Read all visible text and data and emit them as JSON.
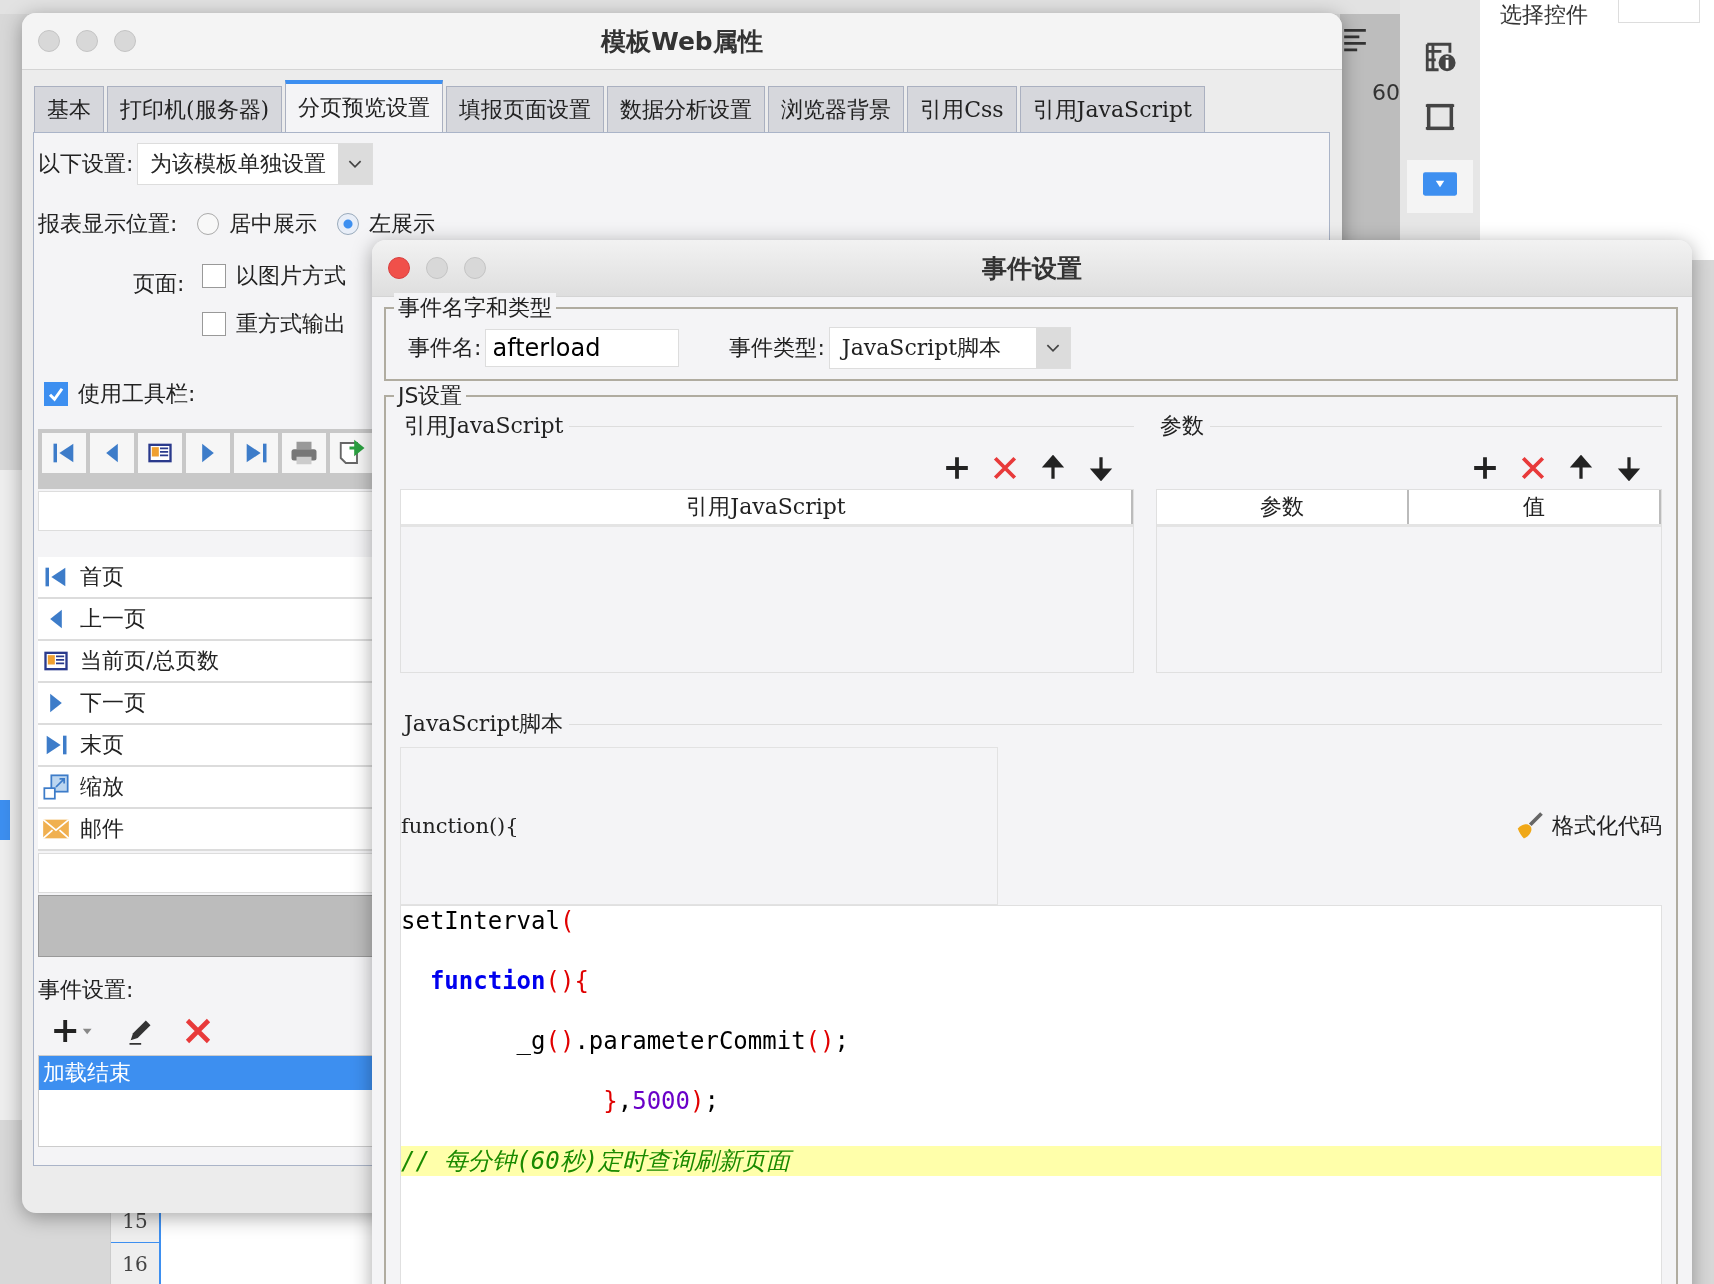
{
  "background": {
    "ruler_number": "60",
    "panel_label": "选择控件",
    "row_numbers": [
      "15",
      "16"
    ]
  },
  "main_window": {
    "title": "模板Web属性",
    "tabs": [
      {
        "label": "基本",
        "selected": false
      },
      {
        "label": "打印机(服务器)",
        "selected": false
      },
      {
        "label": "分页预览设置",
        "selected": true
      },
      {
        "label": "填报页面设置",
        "selected": false
      },
      {
        "label": "数据分析设置",
        "selected": false
      },
      {
        "label": "浏览器背景",
        "selected": false
      },
      {
        "label": "引用Css",
        "selected": false
      },
      {
        "label": "引用JavaScript",
        "selected": false
      }
    ],
    "scope_label": "以下设置:",
    "scope_value": "为该模板单独设置",
    "position_label": "报表显示位置:",
    "position_options": [
      {
        "label": "居中展示",
        "selected": false
      },
      {
        "label": "左展示",
        "selected": true
      }
    ],
    "page_label": "页面:",
    "page_options": [
      {
        "label": "以图片方式",
        "checked": false
      },
      {
        "label": "重方式输出",
        "checked": false
      }
    ],
    "toolbar_toggle": {
      "label": "使用工具栏:",
      "checked": true
    },
    "toolbar_items": [
      {
        "kind": "first",
        "label": "首页"
      },
      {
        "kind": "prev",
        "label": "上一页"
      },
      {
        "kind": "pageinfo",
        "label": "当前页/总页数"
      },
      {
        "kind": "next",
        "label": "下一页"
      },
      {
        "kind": "last",
        "label": "末页"
      },
      {
        "kind": "zoom",
        "label": "缩放"
      },
      {
        "kind": "mail",
        "label": "邮件"
      }
    ],
    "events_label": "事件设置:",
    "events": [
      {
        "label": "加载结束",
        "selected": true
      }
    ]
  },
  "event_dialog": {
    "title": "事件设置",
    "name_group": "事件名字和类型",
    "name_label": "事件名:",
    "name_value": "afterload",
    "type_label": "事件类型:",
    "type_value": "JavaScript脚本",
    "js_group": "JS设置",
    "ref_title": "引用JavaScript",
    "ref_columns": [
      "引用JavaScript"
    ],
    "param_title": "参数",
    "param_columns": [
      "参数",
      "值"
    ],
    "script_title": "JavaScript脚本",
    "script_header": "function(){",
    "format_button": "格式化代码",
    "code_lines": [
      {
        "highlighted": false,
        "tokens": [
          {
            "kind": "plain",
            "text": "setInterval"
          },
          {
            "kind": "paren",
            "text": "("
          }
        ]
      },
      {
        "highlighted": false,
        "tokens": [
          {
            "kind": "keyword",
            "text": "  function"
          },
          {
            "kind": "paren",
            "text": "(){"
          }
        ]
      },
      {
        "highlighted": false,
        "tokens": [
          {
            "kind": "plain",
            "text": "        _g"
          },
          {
            "kind": "paren",
            "text": "()"
          },
          {
            "kind": "plain",
            "text": ".parameterCommit"
          },
          {
            "kind": "paren",
            "text": "()"
          },
          {
            "kind": "plain",
            "text": ";"
          }
        ]
      },
      {
        "highlighted": false,
        "tokens": [
          {
            "kind": "paren",
            "text": "              }"
          },
          {
            "kind": "plain",
            "text": ","
          },
          {
            "kind": "number",
            "text": "5000"
          },
          {
            "kind": "paren",
            "text": ")"
          },
          {
            "kind": "plain",
            "text": ";"
          }
        ]
      },
      {
        "highlighted": true,
        "tokens": [
          {
            "kind": "comment",
            "text": "// 每分钟(60秒)定时查询刷新页面"
          }
        ]
      }
    ]
  }
}
